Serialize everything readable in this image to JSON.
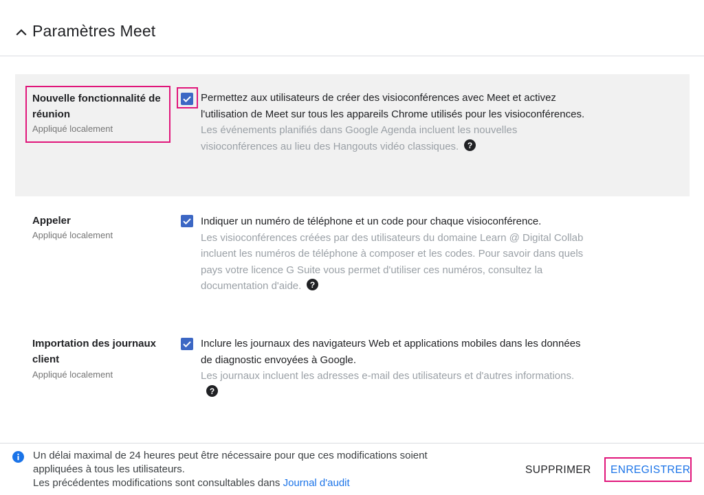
{
  "header": {
    "title": "Paramètres Meet"
  },
  "settings": [
    {
      "name": "Nouvelle fonctionnalité de réunion",
      "scope": "Appliqué localement",
      "checked": true,
      "description": "Permettez aux utilisateurs de créer des visioconférences avec Meet et activez l'utilisation de Meet sur tous les appareils Chrome utilisés pour les visioconférences.",
      "detail": "Les événements planifiés dans Google Agenda incluent les nouvelles visioconférences au lieu des Hangouts vidéo classiques."
    },
    {
      "name": "Appeler",
      "scope": "Appliqué localement",
      "checked": true,
      "description": "Indiquer un numéro de téléphone et un code pour chaque visioconférence.",
      "detail": "Les visioconférences créées par des utilisateurs du domaine Learn @ Digital Collab incluent les numéros de téléphone à composer et les codes. Pour savoir dans quels pays votre licence G Suite vous permet d'utiliser ces numéros, consultez la documentation d'aide."
    },
    {
      "name": "Importation des journaux client",
      "scope": "Appliqué localement",
      "checked": true,
      "description": "Inclure les journaux des navigateurs Web et applications mobiles dans les données de diagnostic envoyées à Google.",
      "detail": "Les journaux incluent les adresses e-mail des utilisateurs et d'autres informations."
    }
  ],
  "footer": {
    "info_line1": "Un délai maximal de 24 heures peut être nécessaire pour que ces modifications soient appliquées à tous les utilisateurs.",
    "info_line2": "Les précédentes modifications sont consultables dans",
    "audit_link": "Journal d'audit",
    "delete_label": "SUPPRIMER",
    "save_label": "ENREGISTRER"
  },
  "colors": {
    "accent": "#1a73e8",
    "checkbox": "#3c67c4",
    "highlight_box": "#e0157a",
    "row_highlight": "#f1f1f1"
  },
  "icons": {
    "collapse": "chevron-up-icon",
    "checkbox": "checkmark-icon",
    "help": "help-circle-icon",
    "info": "info-circle-icon"
  }
}
